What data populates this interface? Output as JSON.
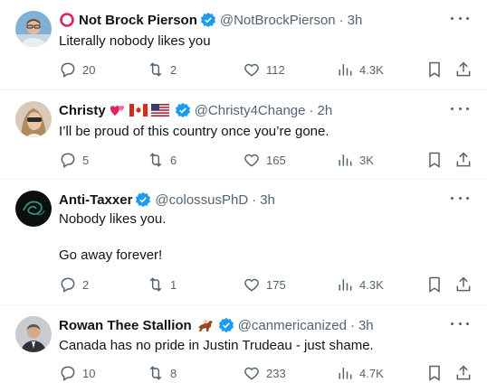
{
  "tweets": [
    {
      "name": "Not Brock Pierson",
      "handle": "@NotBrockPierson",
      "time": "3h",
      "text": "Literally nobody likes you",
      "replies": "20",
      "reposts": "2",
      "likes": "112",
      "views": "4.3K",
      "prefix_icon": "red-ring-emoji"
    },
    {
      "name": "Christy",
      "handle": "@Christy4Change",
      "time": "2h",
      "text": "I’ll be proud of this country once you’re gone.",
      "replies": "5",
      "reposts": "6",
      "likes": "165",
      "views": "3K",
      "suffix_icons": [
        "hearts-emoji",
        "canada-flag-emoji",
        "us-flag-emoji"
      ]
    },
    {
      "name": "Anti-Taxxer",
      "handle": "@colossusPhD",
      "time": "3h",
      "text": "Nobody likes you.\n\nGo away forever!",
      "replies": "2",
      "reposts": "1",
      "likes": "175",
      "views": "4.3K"
    },
    {
      "name": "Rowan Thee Stallion",
      "handle": "@canmericanized",
      "time": "3h",
      "text": "Canada has no pride in Justin Trudeau - just shame.",
      "replies": "10",
      "reposts": "8",
      "likes": "233",
      "views": "4.7K",
      "suffix_icons": [
        "horse-racing-emoji"
      ]
    }
  ],
  "colors": {
    "verified": "#1d9bf0",
    "secondary_text": "#536471",
    "divider": "#eff3f4"
  }
}
